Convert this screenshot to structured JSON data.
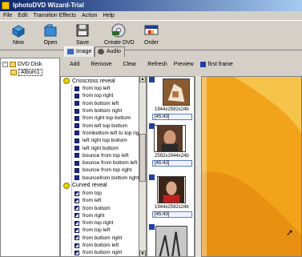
{
  "window": {
    "title": "IphotoDVD Wizard-Trial"
  },
  "menu": [
    "File",
    "Edit",
    "Transition Effects",
    "Action",
    "Help"
  ],
  "toolbar": {
    "new_label": "New",
    "open_label": "Open",
    "save_label": "Save",
    "create_dvd_label": "Create DVD",
    "order_label": "Order"
  },
  "tree": {
    "root_label": "DVD Disk",
    "album_label": "Album1"
  },
  "tabs": {
    "image_label": "Image",
    "audio_label": "Audio"
  },
  "actions": {
    "add": "Add",
    "remove": "Remove",
    "clear": "Clear",
    "refresh": "Refresh",
    "preview": "Preview",
    "first_frame": "first frame"
  },
  "transitions": {
    "group1": "Crisscross reveal",
    "group1_items": [
      "from top left",
      "from top right",
      "from bottom left",
      "from bottom right",
      "from right top bottom",
      "from left top bottom",
      "frombottom left to top right",
      "left right top bottom",
      "left right bottom",
      "bounce from top left",
      "bounce from bottom left",
      "bounce from top right",
      "bouncefrom bottom right"
    ],
    "group2": "Curved reveal",
    "group2_items": [
      "from top",
      "from left",
      "from bottom",
      "from right",
      "from top right",
      "from top left",
      "from bottom right",
      "from bottom left",
      "from bottom right"
    ]
  },
  "thumbnails": [
    {
      "size": "1944x2592x24b",
      "ratio": "[45:43]"
    },
    {
      "size": "2592x1944x24b",
      "ratio": "[45:43]"
    },
    {
      "size": "1944x2592x24b",
      "ratio": "[45:43]"
    }
  ],
  "colors": {
    "title_bar": "#0a246a",
    "preview_bg": "#f2b020",
    "icon_blue": "#1c2c8a"
  }
}
